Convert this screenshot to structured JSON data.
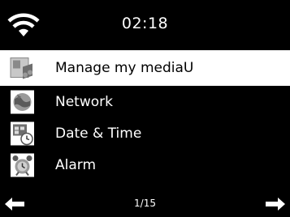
{
  "status": {
    "time": "02:18",
    "wifi_icon": "wifi-icon"
  },
  "menu": {
    "items": [
      {
        "label": "Manage my mediaU",
        "icon": "media-icon",
        "selected": true
      },
      {
        "label": "Network",
        "icon": "network-globe-icon",
        "selected": false
      },
      {
        "label": "Date & Time",
        "icon": "calendar-clock-icon",
        "selected": false
      },
      {
        "label": "Alarm",
        "icon": "alarm-icon",
        "selected": false
      }
    ]
  },
  "footer": {
    "page_indicator": "1/15",
    "back_icon": "arrow-left-icon",
    "forward_icon": "arrow-right-icon"
  },
  "colors": {
    "background": "#000000",
    "text": "#ffffff",
    "selection": "#ffffff"
  }
}
